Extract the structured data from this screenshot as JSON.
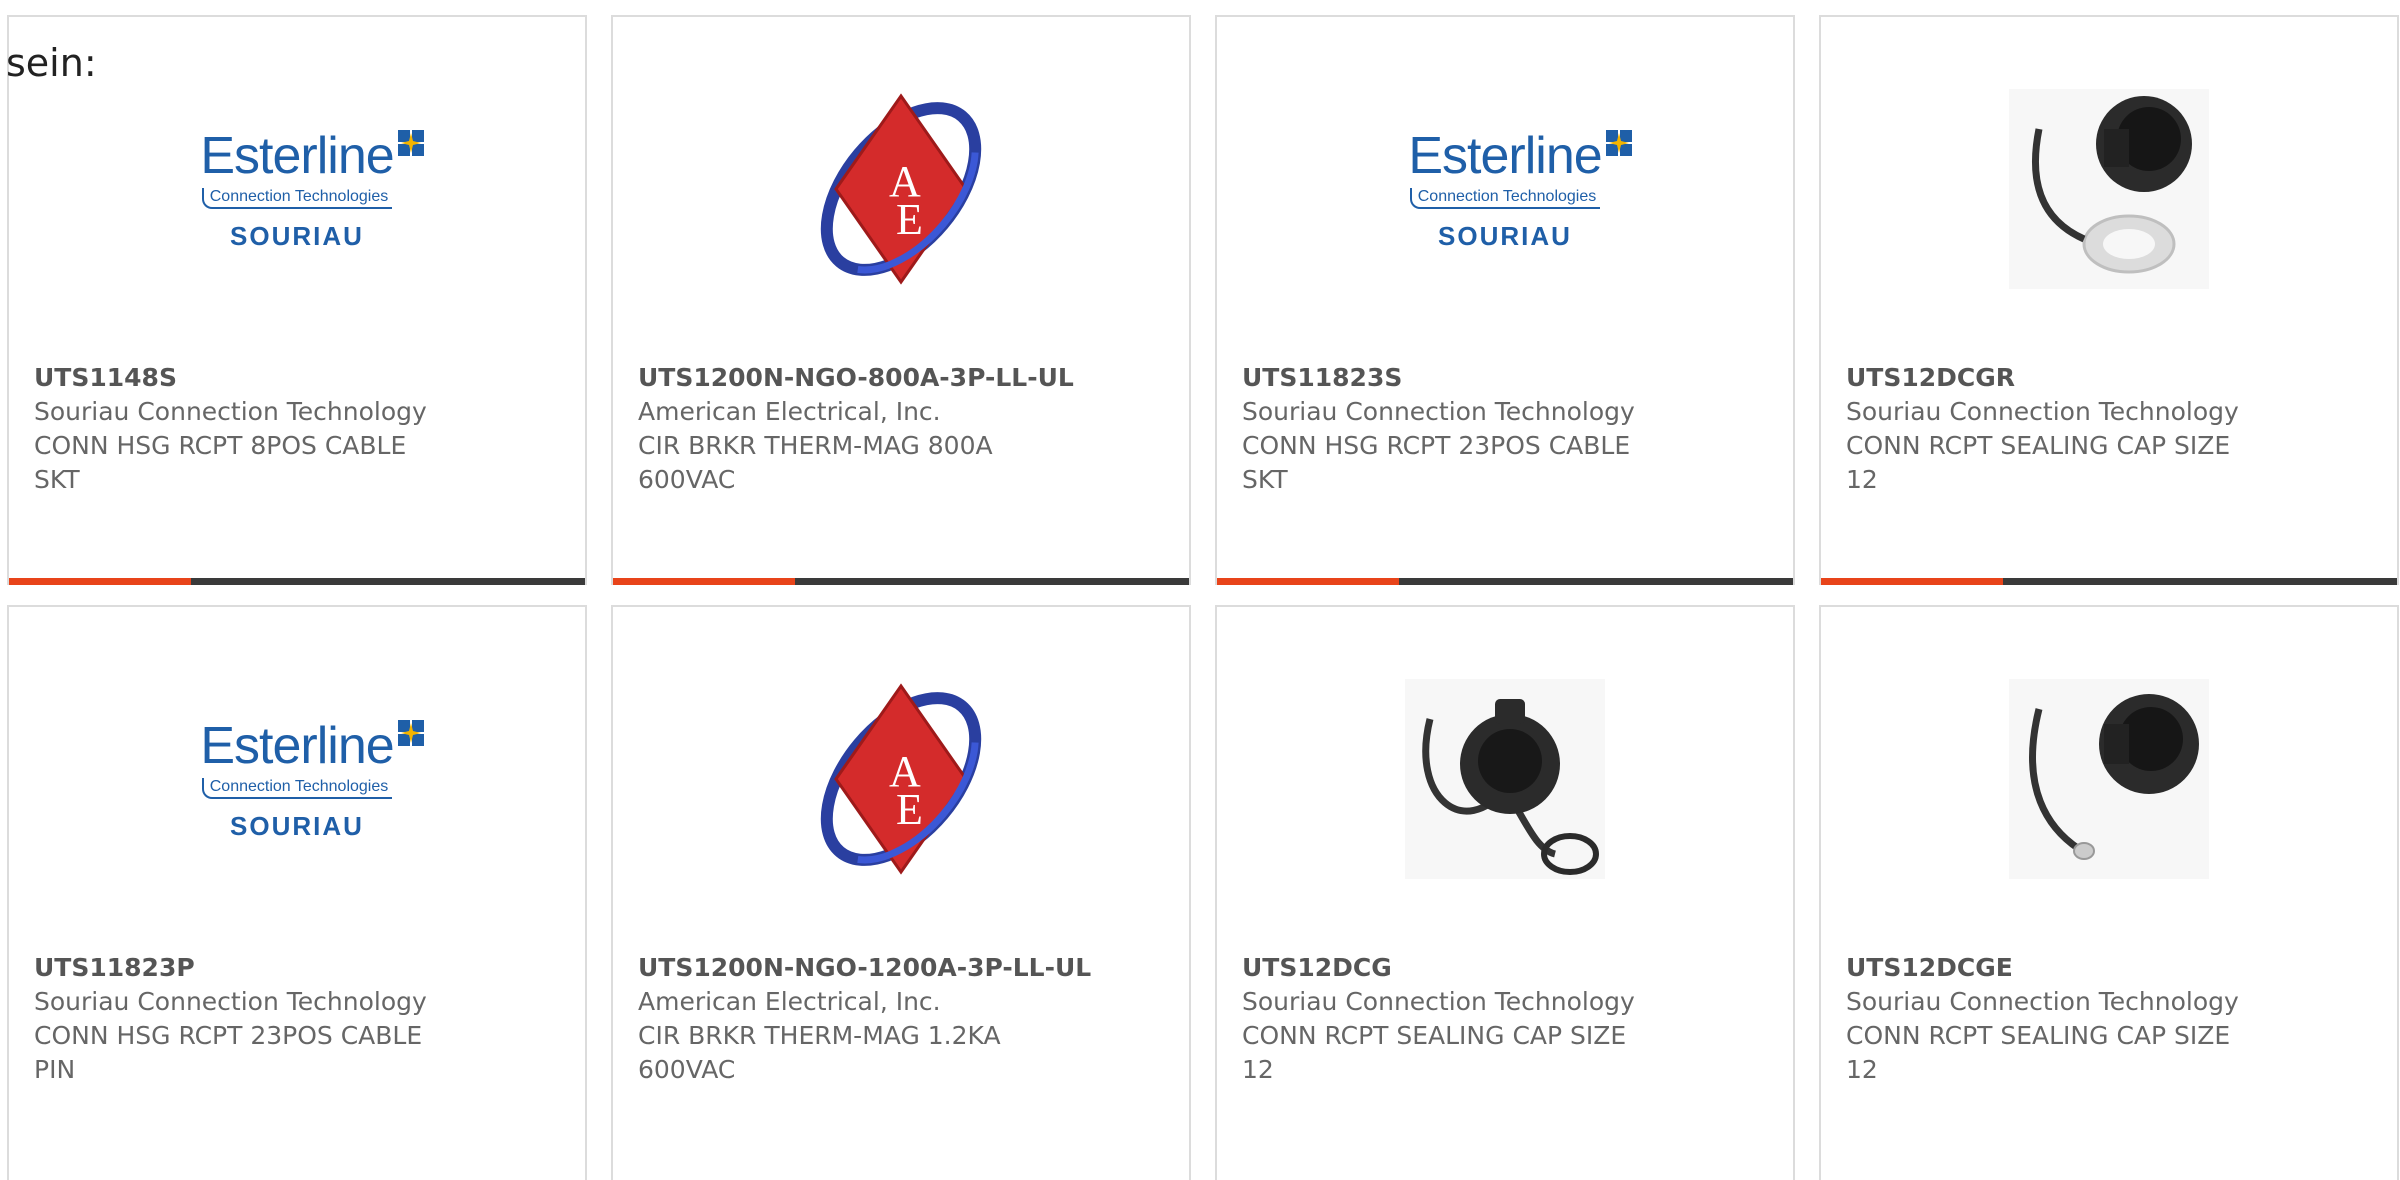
{
  "intro_text": "sein:",
  "colors": {
    "accent": "#e8441a",
    "bar": "#3a3a3a",
    "brand_blue": "#1f5fa8",
    "ae_red": "#d42b2b"
  },
  "esterline_logo": {
    "word": "Esterline",
    "sub": "Connection Technologies",
    "brand": "SOURIAU"
  },
  "products": [
    {
      "pn": "UTS1148S",
      "mfr": "Souriau Connection Technology",
      "desc": "CONN HSG RCPT 8POS CABLE SKT",
      "image": "souriau-logo"
    },
    {
      "pn": "UTS1200N-NGO-800A-3P-LL-UL",
      "mfr": "American Electrical, Inc.",
      "desc": "CIR BRKR THERM-MAG 800A 600VAC",
      "image": "ae-logo"
    },
    {
      "pn": "UTS11823S",
      "mfr": "Souriau Connection Technology",
      "desc": "CONN HSG RCPT 23POS CABLE SKT",
      "image": "souriau-logo"
    },
    {
      "pn": "UTS12DCGR",
      "mfr": "Souriau Connection Technology",
      "desc": "CONN RCPT SEALING CAP SIZE 12",
      "image": "sealing-cap-ring"
    },
    {
      "pn": "UTS11823P",
      "mfr": "Souriau Connection Technology",
      "desc": "CONN HSG RCPT 23POS CABLE PIN",
      "image": "souriau-logo"
    },
    {
      "pn": "UTS1200N-NGO-1200A-3P-LL-UL",
      "mfr": "American Electrical, Inc.",
      "desc": "CIR BRKR THERM-MAG 1.2KA 600VAC",
      "image": "ae-logo"
    },
    {
      "pn": "UTS12DCG",
      "mfr": "Souriau Connection Technology",
      "desc": "CONN RCPT SEALING CAP SIZE 12",
      "image": "sealing-cap-loop"
    },
    {
      "pn": "UTS12DCGE",
      "mfr": "Souriau Connection Technology",
      "desc": "CONN RCPT SEALING CAP SIZE 12",
      "image": "sealing-cap-lug"
    }
  ]
}
